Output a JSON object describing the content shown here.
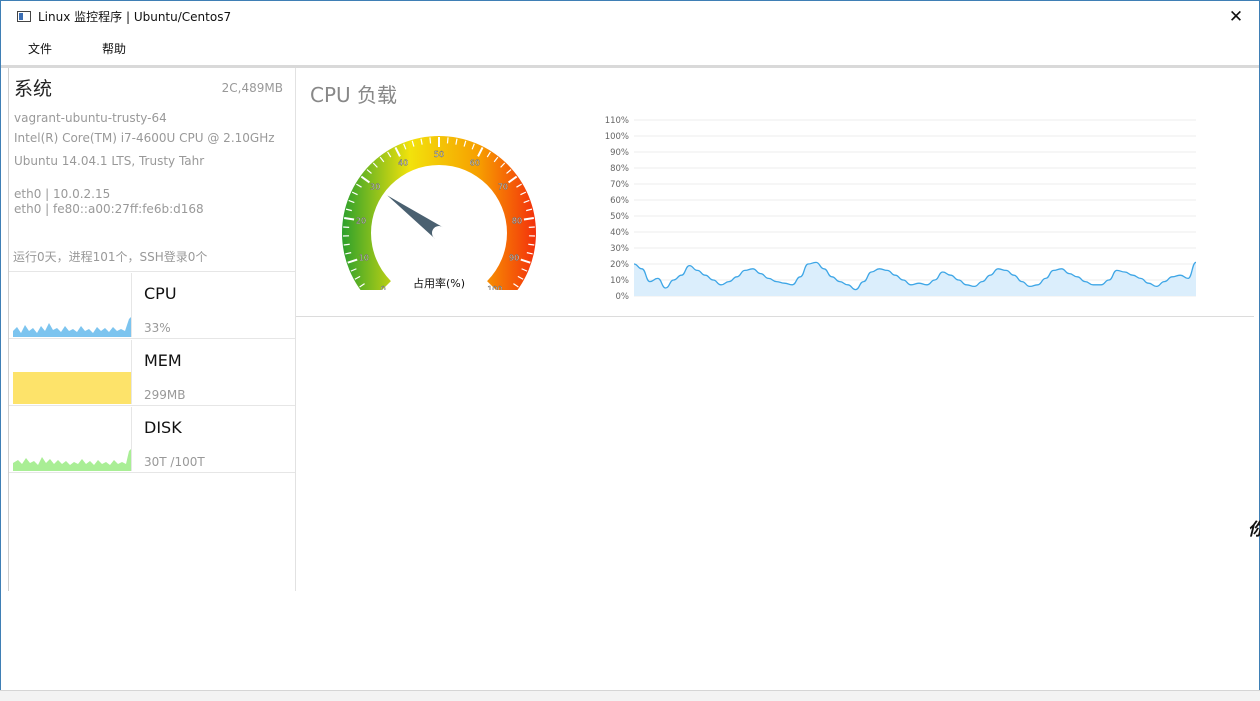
{
  "window": {
    "title": "Linux 监控程序 | Ubuntu/Centos7",
    "close_symbol": "✕"
  },
  "menu": {
    "items": [
      "文件",
      "帮助"
    ]
  },
  "system": {
    "title": "系统",
    "spec": "2C,489MB",
    "hostname": "vagrant-ubuntu-trusty-64",
    "cpu_model": "Intel(R) Core(TM) i7-4600U CPU @ 2.10GHz",
    "os": "Ubuntu 14.04.1 LTS, Trusty Tahr",
    "eth0_ipv4": "eth0 | 10.0.2.15",
    "eth0_ipv6": "eth0 | fe80::a00:27ff:fe6b:d168",
    "uptime": "运行0天，进程101个，SSH登录0个"
  },
  "metrics": [
    {
      "name": "CPU",
      "value": "33%",
      "color": "#7cc4ef"
    },
    {
      "name": "MEM",
      "value": "299MB",
      "color": "#fde36a"
    },
    {
      "name": "DISK",
      "value": "30T /100T",
      "color": "#a9ee95"
    }
  ],
  "cpu_panel": {
    "title": "CPU 负载",
    "gauge_label": "占用率(%)"
  },
  "edge_glyph": "你",
  "chart_data": [
    {
      "type": "gauge",
      "value": 30,
      "range": [
        0,
        100
      ],
      "tick_labels": [
        "0",
        "10",
        "20",
        "30",
        "40",
        "50",
        "60",
        "70",
        "80",
        "90",
        "100"
      ],
      "label": "占用率(%)",
      "colors": [
        "#2ca02c",
        "#f2e20c",
        "#f7a000",
        "#f3300c"
      ]
    },
    {
      "type": "area",
      "ylim": [
        0,
        110
      ],
      "y_tick_labels": [
        "0%",
        "10%",
        "20%",
        "30%",
        "40%",
        "50%",
        "60%",
        "70%",
        "80%",
        "90%",
        "100%",
        "110%"
      ],
      "values": [
        20,
        17,
        9,
        11,
        5,
        10,
        13,
        19,
        16,
        13,
        10,
        7,
        9,
        12,
        16,
        17,
        14,
        11,
        9,
        8,
        7,
        12,
        20,
        21,
        17,
        12,
        9,
        7,
        4,
        9,
        15,
        17,
        16,
        13,
        10,
        7,
        8,
        7,
        10,
        15,
        13,
        10,
        7,
        6,
        9,
        13,
        17,
        16,
        13,
        9,
        6,
        7,
        11,
        16,
        17,
        14,
        12,
        9,
        7,
        7,
        10,
        16,
        15,
        13,
        11,
        8,
        6,
        9,
        12,
        13,
        11,
        21
      ],
      "line_color": "#3ea6e6",
      "fill_color": "#dbeefc"
    }
  ]
}
